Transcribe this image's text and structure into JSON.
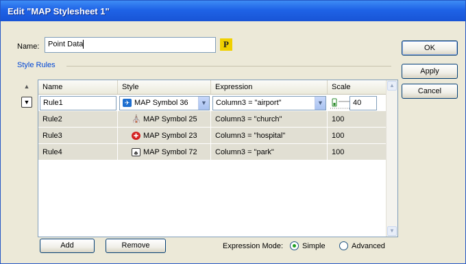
{
  "window": {
    "title": "Edit \"MAP Stylesheet 1\""
  },
  "form": {
    "name_label": "Name:",
    "name_value": "Point Data",
    "p_button": "P",
    "style_rules_label": "Style Rules"
  },
  "side_buttons": {
    "ok": "OK",
    "apply": "Apply",
    "cancel": "Cancel"
  },
  "grid": {
    "columns": [
      "Name",
      "Style",
      "Expression",
      "Scale"
    ],
    "rows": [
      {
        "name": "Rule1",
        "style": "MAP Symbol 36",
        "expression": "Column3 = \"airport\"",
        "scale": "40",
        "icon": "airplane-icon",
        "icon_color": "#1e6fd0"
      },
      {
        "name": "Rule2",
        "style": "MAP Symbol 25",
        "expression": "Column3 = \"church\"",
        "scale": "100",
        "icon": "church-icon",
        "icon_color": "#000000"
      },
      {
        "name": "Rule3",
        "style": "MAP Symbol 23",
        "expression": "Column3 = \"hospital\"",
        "scale": "100",
        "icon": "hospital-icon",
        "icon_color": "#d42020"
      },
      {
        "name": "Rule4",
        "style": "MAP Symbol 72",
        "expression": "Column3 = \"park\"",
        "scale": "100",
        "icon": "park-icon",
        "icon_color": "#333333"
      }
    ]
  },
  "bottom": {
    "add": "Add",
    "remove": "Remove",
    "expression_mode_label": "Expression Mode:",
    "simple": "Simple",
    "advanced": "Advanced",
    "selected_mode": "Simple"
  },
  "colors": {
    "titlebar": "#1f63e6",
    "dialog_bg": "#ece9d8",
    "grid_row_gray": "#e1dfd3"
  }
}
